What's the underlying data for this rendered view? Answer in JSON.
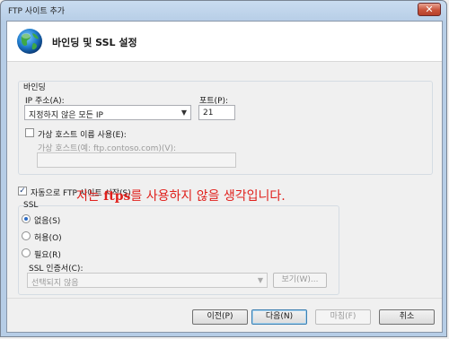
{
  "window": {
    "title": "FTP 사이트 추가",
    "close_glyph": "✕"
  },
  "header": {
    "title": "바인딩 및 SSL 설정",
    "icon": "globe-icon"
  },
  "binding": {
    "section_label": "바인딩",
    "ip_label": "IP 주소(A):",
    "ip_value": "지정하지 않은 모든 IP",
    "port_label": "포트(P):",
    "port_value": "21",
    "virtual_host_checkbox_label": "가상 호스트 이름 사용(E):",
    "virtual_host_checked": false,
    "virtual_host_field_label": "가상 호스트(예: ftp.contoso.com)(V):",
    "virtual_host_value": ""
  },
  "auto_start": {
    "label": "자동으로 FTP 사이트 시작(S)",
    "checked": true
  },
  "ssl": {
    "section_label": "SSL",
    "options": [
      {
        "label": "없음(S)",
        "checked": true
      },
      {
        "label": "허용(O)",
        "checked": false
      },
      {
        "label": "필요(R)",
        "checked": false
      }
    ],
    "cert_label": "SSL 인증서(C):",
    "cert_value": "선택되지 않음",
    "view_button": "보기(W)..."
  },
  "annotation": {
    "prefix": "저는 ",
    "bold": "ftps",
    "suffix": "를 사용하지 않을 생각입니다."
  },
  "footer": {
    "prev": "이전(P)",
    "next": "다음(N)",
    "finish": "마침(F)",
    "cancel": "취소"
  },
  "colors": {
    "annotation": "#e0201c",
    "accent": "#2e6cc4"
  }
}
